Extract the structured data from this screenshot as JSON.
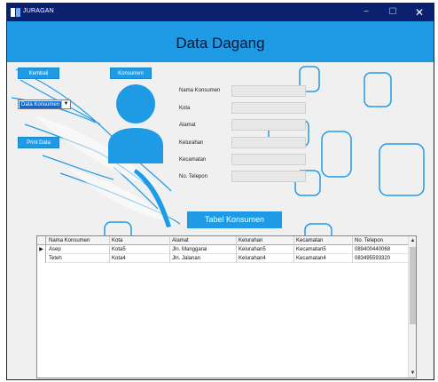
{
  "window": {
    "title": "JURAGAN",
    "controls": {
      "minimize": "−",
      "maximize": "☐",
      "close": "✕"
    }
  },
  "header": {
    "title": "Data Dagang"
  },
  "nav": {
    "kembali": "Kembali",
    "konsumen": "Konsumen",
    "print_data": "Print Data",
    "combo_selected": "Data Konsumen"
  },
  "form": {
    "labels": [
      "Nama Konsumen",
      "Kota",
      "Alamat",
      "Kelurahan",
      "Kecamatan",
      "No. Telepon"
    ],
    "values": [
      "",
      "",
      "",
      "",
      "",
      ""
    ]
  },
  "tabel_button": "Tabel Konsumen",
  "table": {
    "columns": [
      "Nama Konsumen",
      "Kota",
      "Alamat",
      "Kelurahan",
      "Kecamatan",
      "No. Telepon"
    ],
    "rows": [
      [
        "Asep",
        "Kota5",
        "Jln. Manggarai",
        "Kelurahan5",
        "Kecamatan5",
        "089400440068"
      ],
      [
        "Teteh",
        "Kota4",
        "Jln. Jalanan",
        "Kelurahan4",
        "Kecamatan4",
        "083495593320"
      ]
    ],
    "current_row_marker": "▶"
  },
  "colors": {
    "accent": "#1f9be6",
    "titlebar": "#0b2170"
  }
}
